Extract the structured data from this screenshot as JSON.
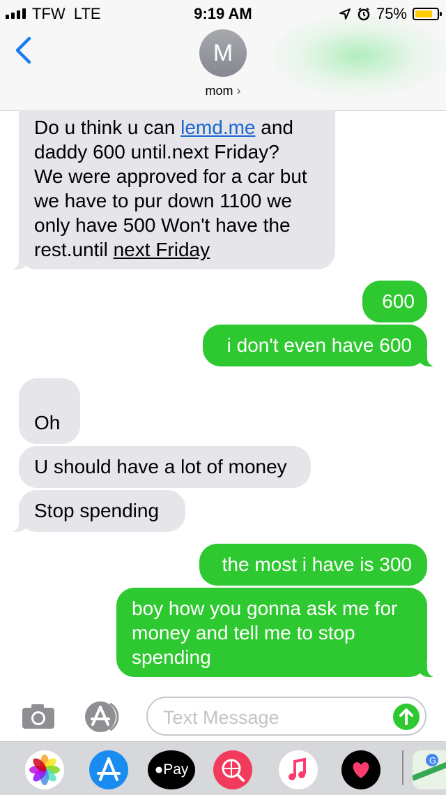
{
  "status_bar": {
    "carrier": "TFW",
    "network": "LTE",
    "time": "9:19 AM",
    "battery": "75%"
  },
  "header": {
    "avatar_initial": "M",
    "contact_name": "mom",
    "contact_chevron": "›"
  },
  "messages": [
    {
      "direction": "incoming",
      "lines": [
        {
          "before": "Do u think u can ",
          "link": "lemd.me",
          "after": " and"
        },
        {
          "text": "daddy 600 until.next Friday?"
        },
        {
          "text": "We were approved for a car but"
        },
        {
          "text": "we have to pur down 1100 we"
        },
        {
          "text": "only have 500  Won't have the"
        },
        {
          "before": "rest.until ",
          "underlined": "next Friday"
        }
      ]
    },
    {
      "direction": "outgoing",
      "text": "600"
    },
    {
      "direction": "outgoing",
      "text": "i don't even have 600"
    },
    {
      "direction": "incoming",
      "text": "Oh"
    },
    {
      "direction": "incoming",
      "text": "U should have a lot of money"
    },
    {
      "direction": "incoming",
      "text": "Stop spending"
    },
    {
      "direction": "outgoing",
      "text": "the most i have is 300"
    },
    {
      "direction": "outgoing",
      "lines": [
        {
          "text": "boy how you gonna ask me for"
        },
        {
          "text": "money and tell me to stop"
        },
        {
          "text": "spending"
        }
      ]
    }
  ],
  "composer": {
    "placeholder": "Text Message"
  },
  "app_tray": {
    "apple_pay_label": "Pay",
    "icons": [
      "photos-icon",
      "app-store-icon",
      "apple-pay-icon",
      "web-search-icon",
      "music-icon",
      "digital-touch-icon",
      "maps-icon"
    ]
  },
  "colors": {
    "incoming_bubble": "#e5e5ea",
    "outgoing_bubble": "#2ec830",
    "link": "#1a66ce",
    "accent_blue": "#1a7cf5"
  }
}
